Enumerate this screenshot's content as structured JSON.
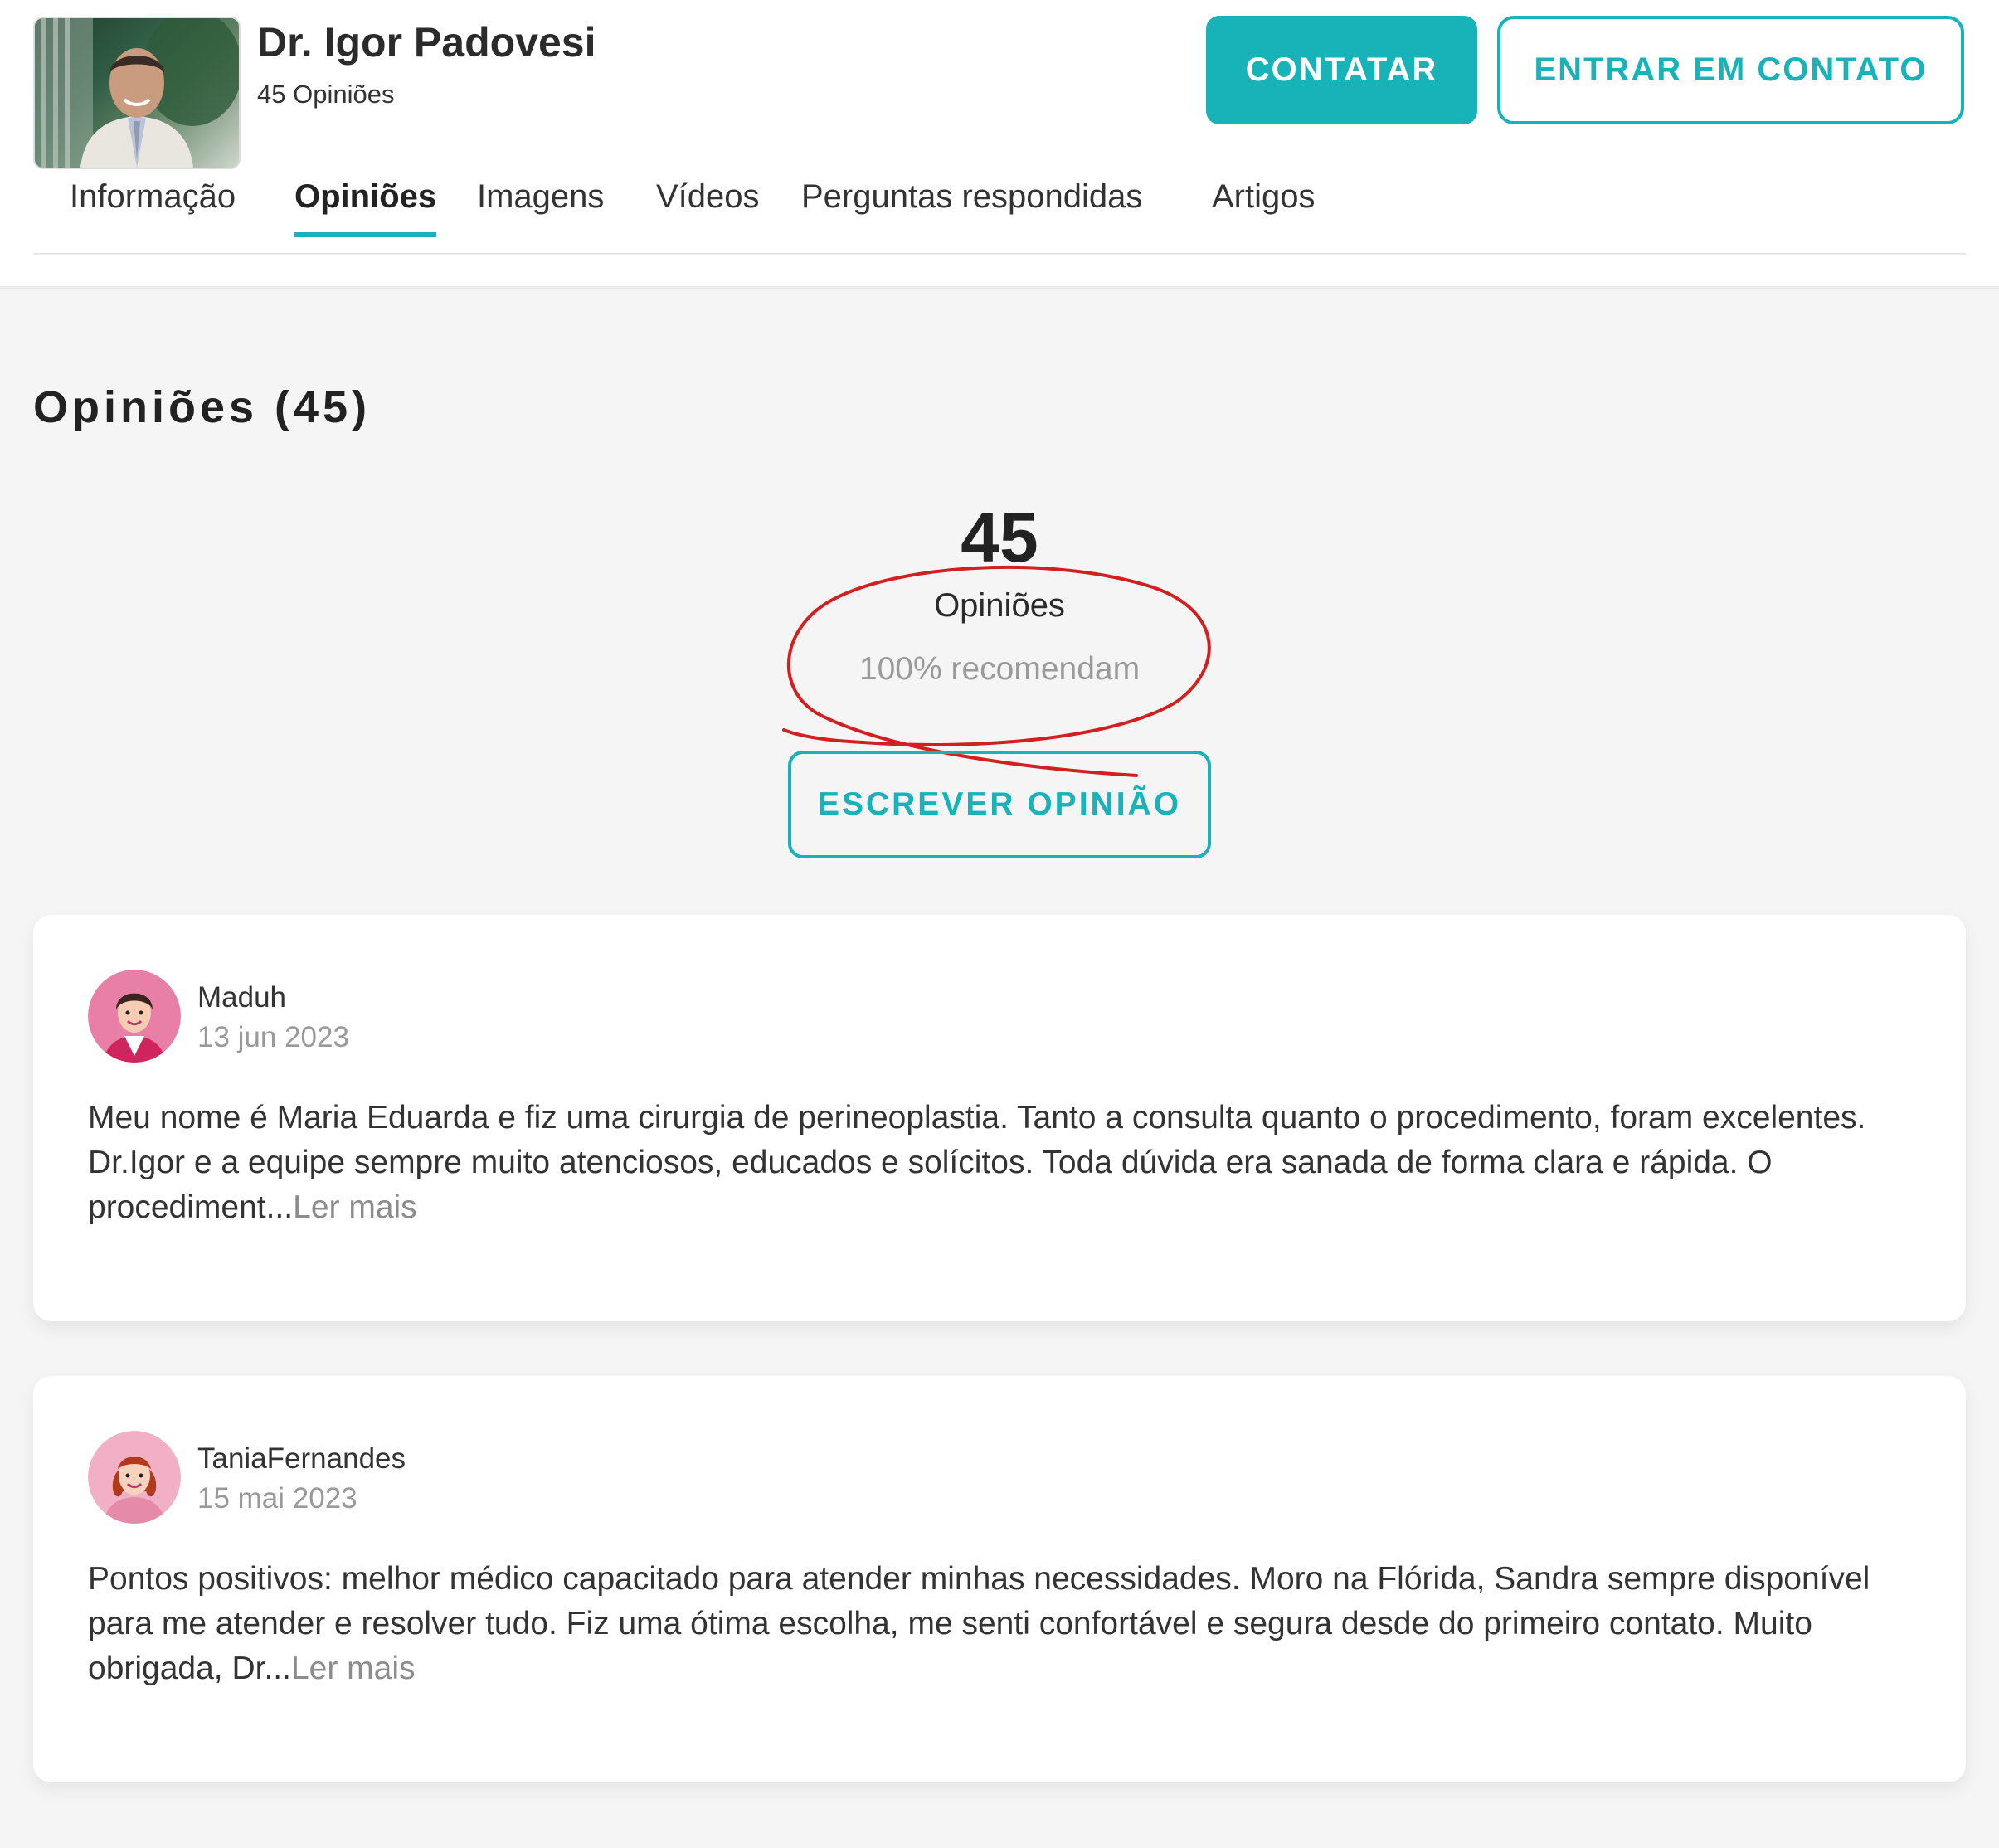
{
  "doctor": {
    "name": "Dr. Igor Padovesi",
    "reviews_count_label": "45 Opiniões"
  },
  "actions": {
    "contact_label": "CONTATAR",
    "get_in_touch_label": "ENTRAR EM CONTATO",
    "write_review_label": "ESCREVER OPINIÃO"
  },
  "tabs": [
    {
      "label": "Informação",
      "active": false
    },
    {
      "label": "Opiniões",
      "active": true
    },
    {
      "label": "Imagens",
      "active": false
    },
    {
      "label": "Vídeos",
      "active": false
    },
    {
      "label": "Perguntas respondidas",
      "active": false
    },
    {
      "label": "Artigos",
      "active": false
    }
  ],
  "section": {
    "title": "Opiniões (45)"
  },
  "summary": {
    "count": "45",
    "label": "Opiniões",
    "recommend": "100% recomendam"
  },
  "reviews": [
    {
      "user": "Maduh",
      "date": "13 jun 2023",
      "text": "Meu nome é Maria Eduarda e fiz uma cirurgia de perineoplastia. Tanto a consulta quanto o procedimento, foram excelentes. Dr.Igor e a equipe sempre muito atenciosos, educados e solícitos. Toda dúvida era sanada de forma clara e rápida. O procediment...",
      "more": "Ler mais"
    },
    {
      "user": "TaniaFernandes",
      "date": "15 mai 2023",
      "text": "Pontos positivos: melhor médico capacitado para atender minhas necessidades. Moro na Flórida, Sandra sempre disponível para me atender e resolver tudo. Fiz uma ótima escolha, me senti confortável e segura desde do primeiro contato. Muito obrigada, Dr...",
      "more": "Ler mais"
    }
  ],
  "colors": {
    "accent": "#17b3b8",
    "annotation_red": "#d21f1f",
    "background": "#f5f5f5"
  }
}
